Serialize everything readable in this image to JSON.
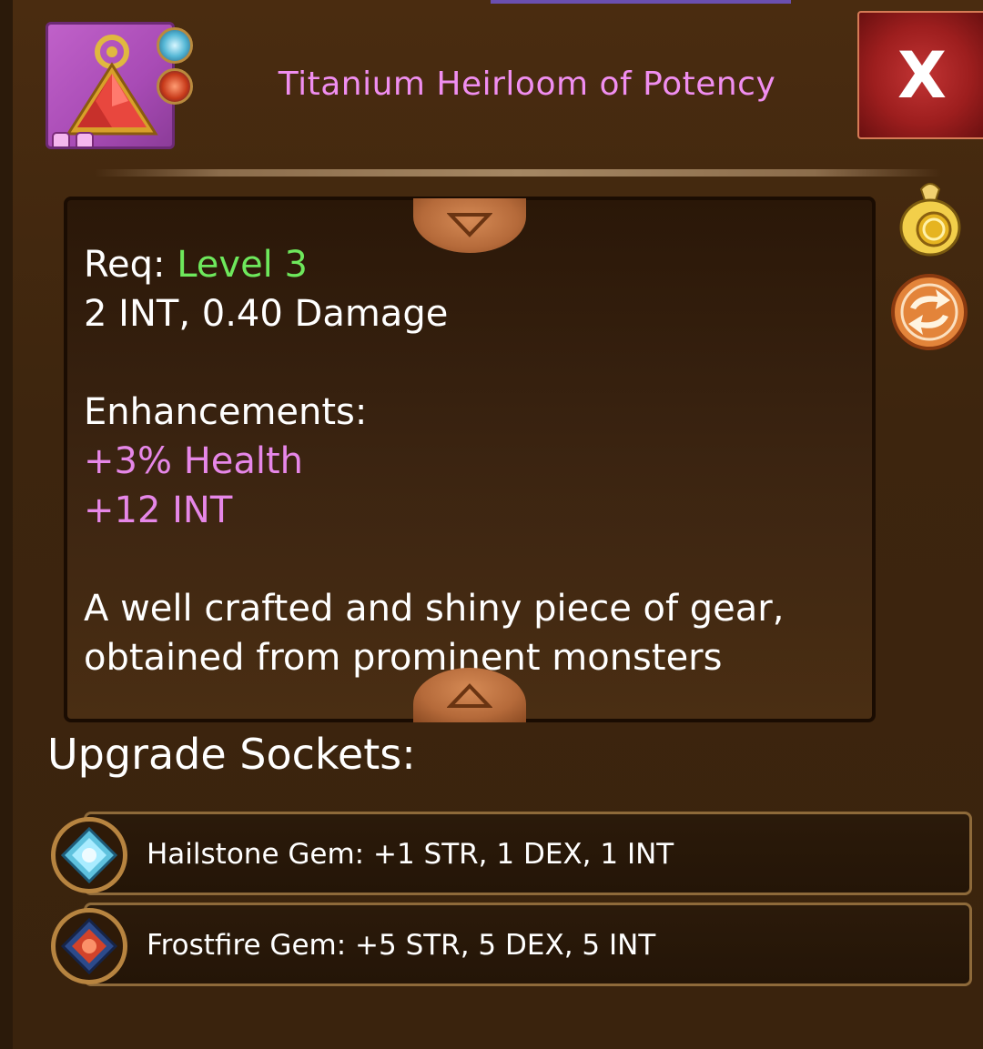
{
  "item": {
    "title": "Titanium Heirloom of Potency",
    "icon": "red-triangle-amulet-icon",
    "slot_gems": [
      "hailstone-gem-icon",
      "frostfire-gem-icon"
    ]
  },
  "close_button": {
    "label": "X"
  },
  "description": {
    "req_label": "Req:",
    "req_value": "Level 3",
    "stats_line": "2 INT, 0.40 Damage",
    "enhancements_label": "Enhancements:",
    "enhancements": [
      "+3% Health",
      "+12 INT"
    ],
    "flavor_lines": [
      "A well crafted and shiny piece of gear,",
      "obtained from prominent monsters"
    ]
  },
  "side_actions": [
    "gold-bag-icon",
    "swap-arrows-icon"
  ],
  "sockets": {
    "heading": "Upgrade Sockets:",
    "items": [
      {
        "label": "Hailstone Gem: +1 STR, 1 DEX, 1 INT",
        "icon": "hailstone-gem-icon"
      },
      {
        "label": "Frostfire Gem: +5 STR, 5 DEX, 5 INT",
        "icon": "frostfire-gem-icon"
      }
    ]
  },
  "colors": {
    "title": "#f08ef0",
    "level": "#6ee85c",
    "enhancement": "#e687e8",
    "close_button": "#9d1e1e"
  }
}
